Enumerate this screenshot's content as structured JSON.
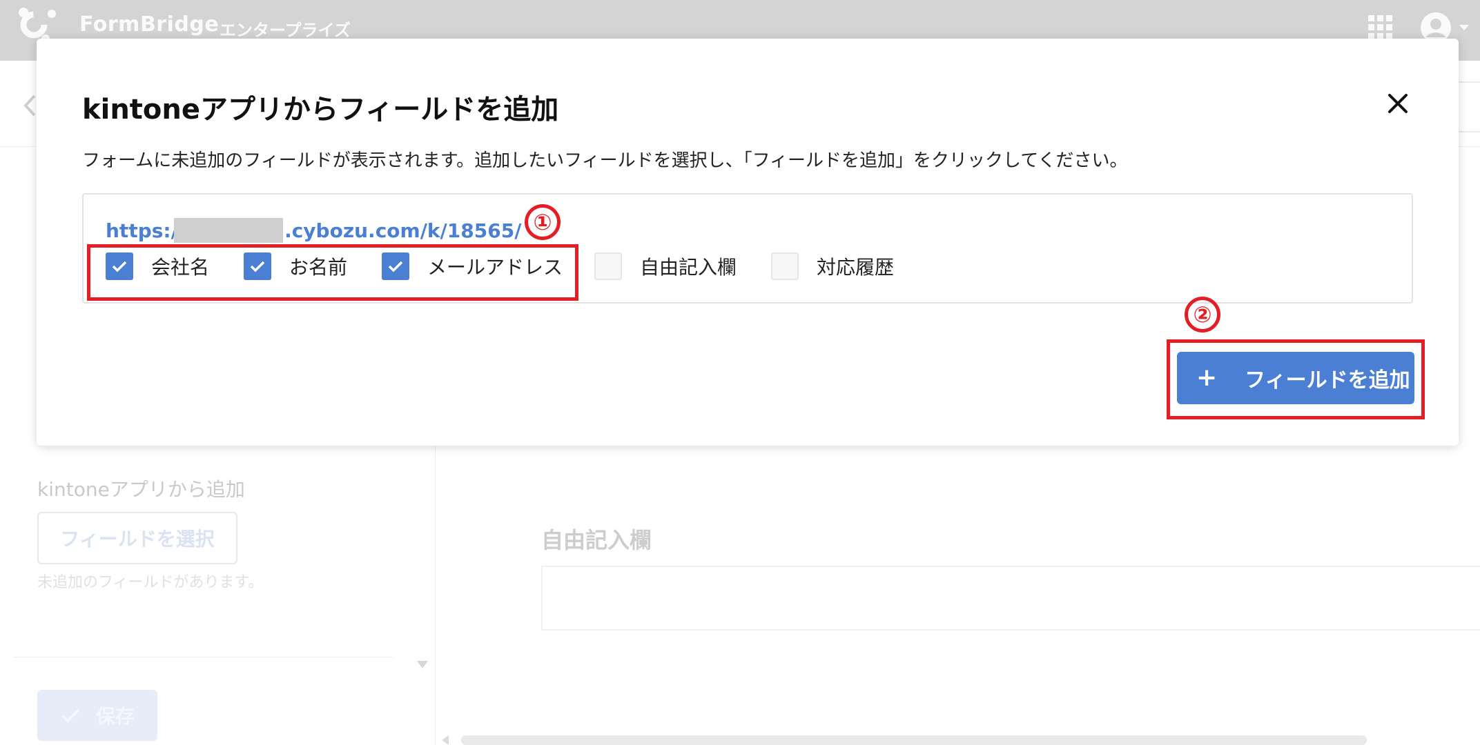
{
  "header": {
    "brand": "FormBridge",
    "edition": "エンタープライズ",
    "apps_icon": "apps-grid-icon",
    "user_icon": "user-avatar-icon"
  },
  "background": {
    "back_icon": "chevron-left-icon",
    "sidebar_label": "kintoneアプリから追加",
    "select_fields_button": "フィールドを選択",
    "sidebar_note": "未追加のフィールドがあります。",
    "save_button": "保存",
    "field_title": "自由記入欄"
  },
  "modal": {
    "title": "kintoneアプリからフィールドを追加",
    "close_icon": "close-icon",
    "description": "フォームに未追加のフィールドが表示されます。追加したいフィールドを選択し、「フィールドを追加」をクリックしてください。",
    "app_url_prefix": "https://",
    "app_url_suffix": ".cybozu.com/k/18565/",
    "fields": [
      {
        "label": "会社名",
        "checked": true
      },
      {
        "label": "お名前",
        "checked": true
      },
      {
        "label": "メールアドレス",
        "checked": true
      },
      {
        "label": "自由記入欄",
        "checked": false
      },
      {
        "label": "対応履歴",
        "checked": false
      }
    ],
    "add_button_label": "フィールドを追加",
    "add_button_icon": "plus-icon"
  },
  "annotations": {
    "step1": "①",
    "step2": "②"
  },
  "colors": {
    "accent": "#4a7fd4",
    "annotation_red": "#e41e26"
  }
}
